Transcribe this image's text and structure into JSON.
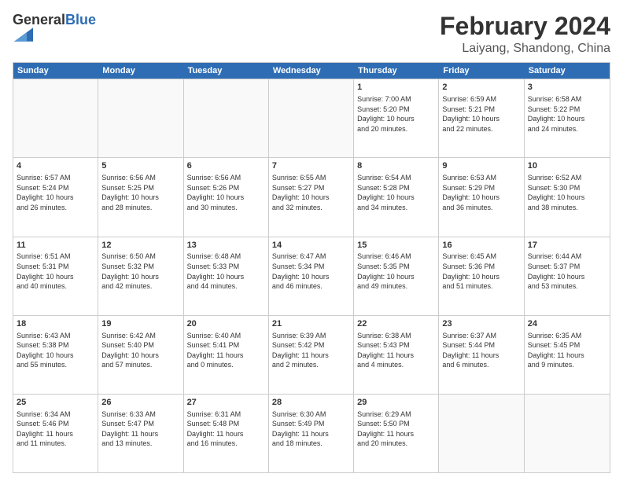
{
  "logo": {
    "general": "General",
    "blue": "Blue"
  },
  "title": {
    "month": "February 2024",
    "location": "Laiyang, Shandong, China"
  },
  "header_days": [
    "Sunday",
    "Monday",
    "Tuesday",
    "Wednesday",
    "Thursday",
    "Friday",
    "Saturday"
  ],
  "rows": [
    [
      {
        "day": "",
        "detail": ""
      },
      {
        "day": "",
        "detail": ""
      },
      {
        "day": "",
        "detail": ""
      },
      {
        "day": "",
        "detail": ""
      },
      {
        "day": "1",
        "detail": "Sunrise: 7:00 AM\nSunset: 5:20 PM\nDaylight: 10 hours\nand 20 minutes."
      },
      {
        "day": "2",
        "detail": "Sunrise: 6:59 AM\nSunset: 5:21 PM\nDaylight: 10 hours\nand 22 minutes."
      },
      {
        "day": "3",
        "detail": "Sunrise: 6:58 AM\nSunset: 5:22 PM\nDaylight: 10 hours\nand 24 minutes."
      }
    ],
    [
      {
        "day": "4",
        "detail": "Sunrise: 6:57 AM\nSunset: 5:24 PM\nDaylight: 10 hours\nand 26 minutes."
      },
      {
        "day": "5",
        "detail": "Sunrise: 6:56 AM\nSunset: 5:25 PM\nDaylight: 10 hours\nand 28 minutes."
      },
      {
        "day": "6",
        "detail": "Sunrise: 6:56 AM\nSunset: 5:26 PM\nDaylight: 10 hours\nand 30 minutes."
      },
      {
        "day": "7",
        "detail": "Sunrise: 6:55 AM\nSunset: 5:27 PM\nDaylight: 10 hours\nand 32 minutes."
      },
      {
        "day": "8",
        "detail": "Sunrise: 6:54 AM\nSunset: 5:28 PM\nDaylight: 10 hours\nand 34 minutes."
      },
      {
        "day": "9",
        "detail": "Sunrise: 6:53 AM\nSunset: 5:29 PM\nDaylight: 10 hours\nand 36 minutes."
      },
      {
        "day": "10",
        "detail": "Sunrise: 6:52 AM\nSunset: 5:30 PM\nDaylight: 10 hours\nand 38 minutes."
      }
    ],
    [
      {
        "day": "11",
        "detail": "Sunrise: 6:51 AM\nSunset: 5:31 PM\nDaylight: 10 hours\nand 40 minutes."
      },
      {
        "day": "12",
        "detail": "Sunrise: 6:50 AM\nSunset: 5:32 PM\nDaylight: 10 hours\nand 42 minutes."
      },
      {
        "day": "13",
        "detail": "Sunrise: 6:48 AM\nSunset: 5:33 PM\nDaylight: 10 hours\nand 44 minutes."
      },
      {
        "day": "14",
        "detail": "Sunrise: 6:47 AM\nSunset: 5:34 PM\nDaylight: 10 hours\nand 46 minutes."
      },
      {
        "day": "15",
        "detail": "Sunrise: 6:46 AM\nSunset: 5:35 PM\nDaylight: 10 hours\nand 49 minutes."
      },
      {
        "day": "16",
        "detail": "Sunrise: 6:45 AM\nSunset: 5:36 PM\nDaylight: 10 hours\nand 51 minutes."
      },
      {
        "day": "17",
        "detail": "Sunrise: 6:44 AM\nSunset: 5:37 PM\nDaylight: 10 hours\nand 53 minutes."
      }
    ],
    [
      {
        "day": "18",
        "detail": "Sunrise: 6:43 AM\nSunset: 5:38 PM\nDaylight: 10 hours\nand 55 minutes."
      },
      {
        "day": "19",
        "detail": "Sunrise: 6:42 AM\nSunset: 5:40 PM\nDaylight: 10 hours\nand 57 minutes."
      },
      {
        "day": "20",
        "detail": "Sunrise: 6:40 AM\nSunset: 5:41 PM\nDaylight: 11 hours\nand 0 minutes."
      },
      {
        "day": "21",
        "detail": "Sunrise: 6:39 AM\nSunset: 5:42 PM\nDaylight: 11 hours\nand 2 minutes."
      },
      {
        "day": "22",
        "detail": "Sunrise: 6:38 AM\nSunset: 5:43 PM\nDaylight: 11 hours\nand 4 minutes."
      },
      {
        "day": "23",
        "detail": "Sunrise: 6:37 AM\nSunset: 5:44 PM\nDaylight: 11 hours\nand 6 minutes."
      },
      {
        "day": "24",
        "detail": "Sunrise: 6:35 AM\nSunset: 5:45 PM\nDaylight: 11 hours\nand 9 minutes."
      }
    ],
    [
      {
        "day": "25",
        "detail": "Sunrise: 6:34 AM\nSunset: 5:46 PM\nDaylight: 11 hours\nand 11 minutes."
      },
      {
        "day": "26",
        "detail": "Sunrise: 6:33 AM\nSunset: 5:47 PM\nDaylight: 11 hours\nand 13 minutes."
      },
      {
        "day": "27",
        "detail": "Sunrise: 6:31 AM\nSunset: 5:48 PM\nDaylight: 11 hours\nand 16 minutes."
      },
      {
        "day": "28",
        "detail": "Sunrise: 6:30 AM\nSunset: 5:49 PM\nDaylight: 11 hours\nand 18 minutes."
      },
      {
        "day": "29",
        "detail": "Sunrise: 6:29 AM\nSunset: 5:50 PM\nDaylight: 11 hours\nand 20 minutes."
      },
      {
        "day": "",
        "detail": ""
      },
      {
        "day": "",
        "detail": ""
      }
    ]
  ]
}
